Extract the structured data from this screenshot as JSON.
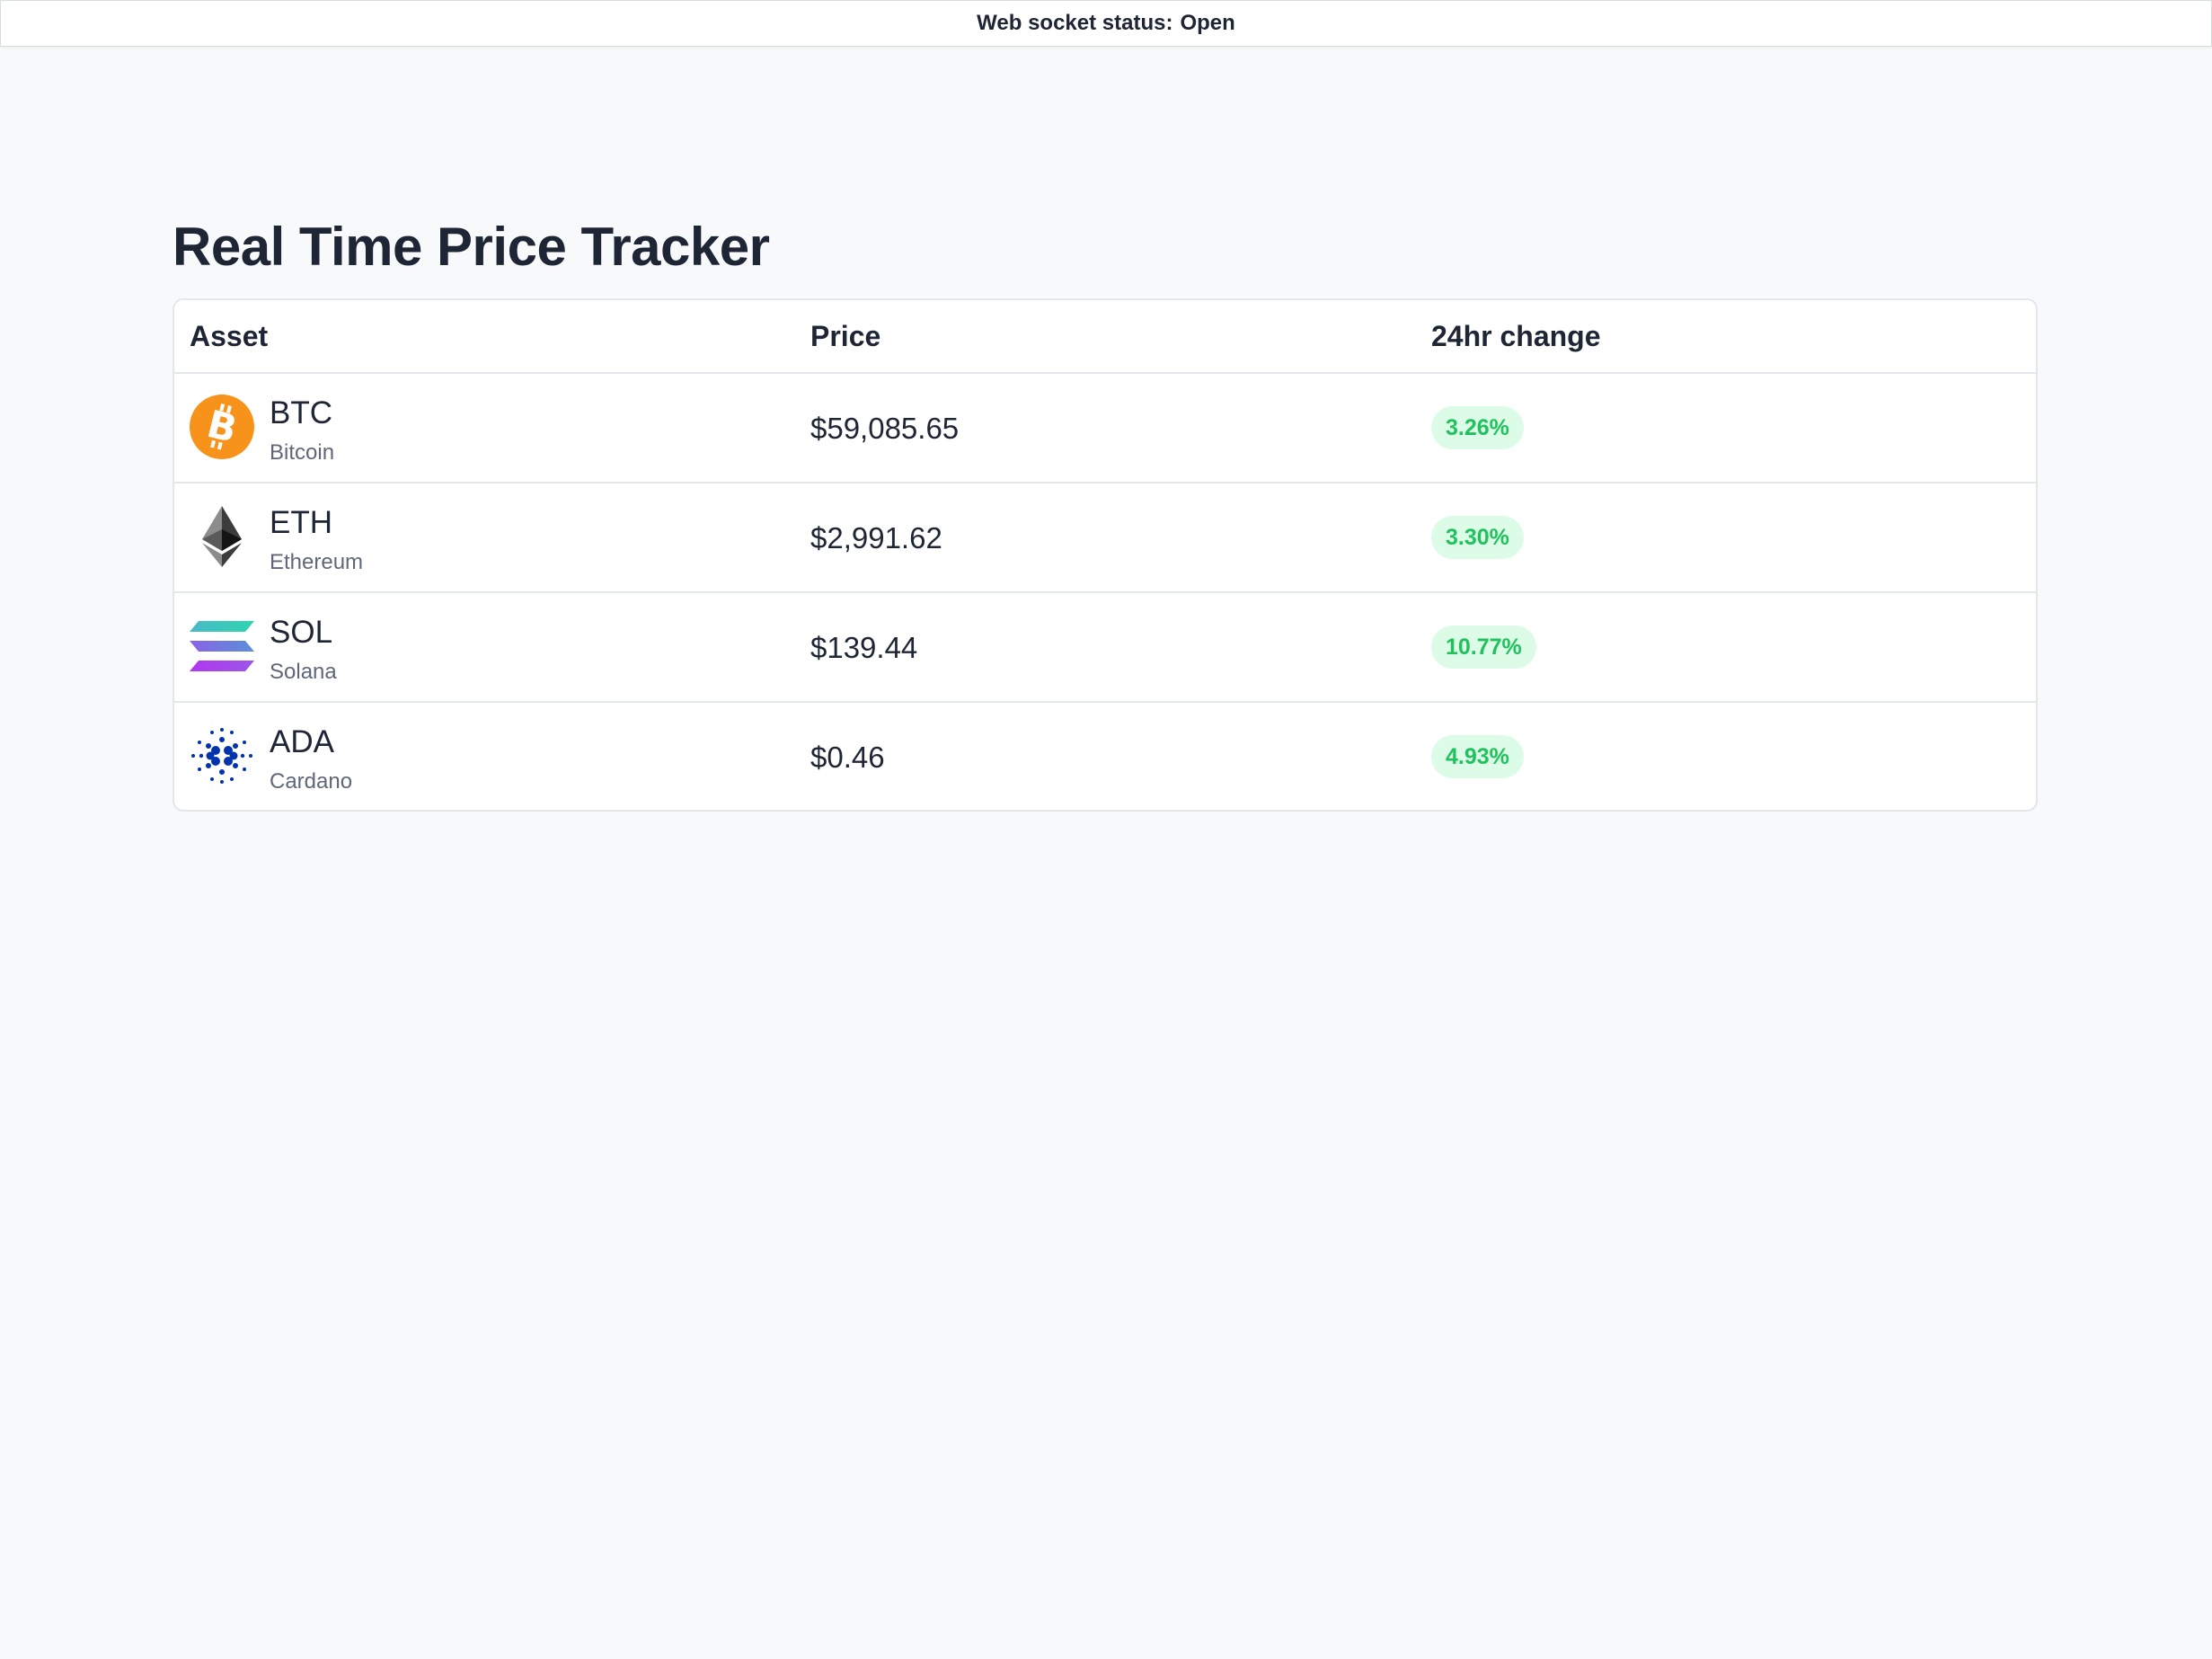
{
  "status": {
    "label": "Web socket status:",
    "value": "Open"
  },
  "page": {
    "title": "Real Time Price Tracker"
  },
  "table": {
    "columns": [
      "Asset",
      "Price",
      "24hr change"
    ],
    "rows": [
      {
        "symbol": "BTC",
        "name": "Bitcoin",
        "price": "$59,085.65",
        "change": "3.26%",
        "icon": "bitcoin-icon",
        "icon_color": "#f7931a"
      },
      {
        "symbol": "ETH",
        "name": "Ethereum",
        "price": "$2,991.62",
        "change": "3.30%",
        "icon": "ethereum-icon",
        "icon_color": "#3c3c3d"
      },
      {
        "symbol": "SOL",
        "name": "Solana",
        "price": "$139.44",
        "change": "10.77%",
        "icon": "solana-icon",
        "icon_color": "#9945ff"
      },
      {
        "symbol": "ADA",
        "name": "Cardano",
        "price": "$0.46",
        "change": "4.93%",
        "icon": "cardano-icon",
        "icon_color": "#0033ad"
      }
    ]
  },
  "colors": {
    "background": "#f7f9fb",
    "text": "#1e2535",
    "muted_text": "#5f6878",
    "positive": "#21c25e",
    "positive_bg": "#dcfce7",
    "border": "#e3e7ec"
  }
}
